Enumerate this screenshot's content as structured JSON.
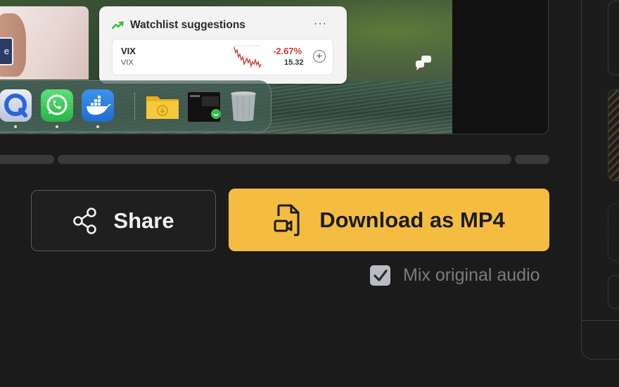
{
  "preview": {
    "person_tag": "e",
    "widget": {
      "title": "Watchlist suggestions",
      "more": "···",
      "ticker": {
        "symbol": "VIX",
        "name": "VIX",
        "change": "-2.67%",
        "price": "15.32",
        "add": "+"
      }
    },
    "dock_apps": [
      "quicktime-icon",
      "whatsapp-icon",
      "docker-icon",
      "downloads-folder-icon",
      "window-thumbnail-icon",
      "trash-icon"
    ]
  },
  "actions": {
    "share_label": "Share",
    "download_label": "Download as MP4",
    "mix_audio_label": "Mix original audio",
    "mix_audio_checked": true
  },
  "colors": {
    "background": "#1b1b1b",
    "primary_button": "#f4bd41",
    "negative_change": "#d23b2f"
  }
}
